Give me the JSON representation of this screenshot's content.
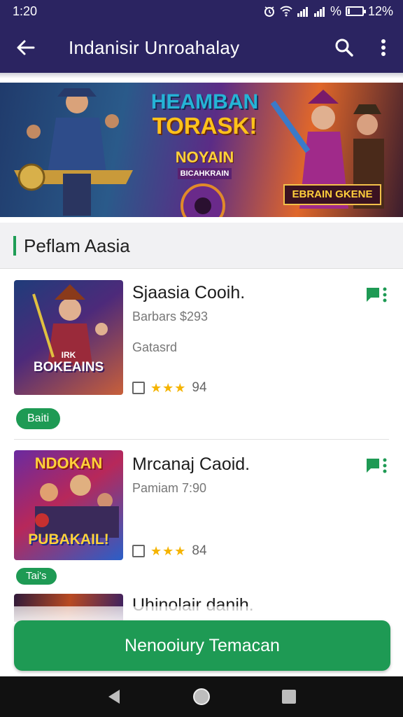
{
  "status_bar": {
    "time": "1:20",
    "signal_text": "%",
    "battery_text": "12%",
    "battery_level": 0.12,
    "icons": [
      "alarm-icon",
      "wifi-icon",
      "signal-icon",
      "signal-icon",
      "battery-icon"
    ]
  },
  "app_bar": {
    "title": "Indanisir Unroahalay",
    "back_icon": "back-arrow-icon",
    "search_icon": "search-icon",
    "more_icon": "more-vert-icon"
  },
  "banner": {
    "line1": "HEAMBAN",
    "line2": "TORASK!",
    "line3": "NOYAIN",
    "line4": "BICAHKRAIN",
    "badge": "EBRAIN GKENE"
  },
  "section": {
    "title": "Peflam Aasia"
  },
  "items": [
    {
      "title": "Sjaasia Cooih.",
      "subtitle": "Barbars $293",
      "subtitle2": "Gatasrd",
      "stars": "★★★",
      "rating": "94",
      "tag": "Baiti",
      "thumb_text": "BOKEAINS",
      "thumb_small_text": "IRK",
      "flag_icon": "flag-icon"
    },
    {
      "title": "Mrcanaj Caoid.",
      "subtitle": "Pamiam 7:90",
      "stars": "★★★",
      "rating": "84",
      "tag": "Tai's",
      "thumb_text_top": "NDOKAN",
      "thumb_text_bottom": "PUBAKAIL!",
      "flag_icon": "flag-icon"
    },
    {
      "title": "Uhinolair danih."
    }
  ],
  "cta": {
    "label": "Nenooiury Temacan"
  },
  "nav_bar": {
    "back": "nav-back-icon",
    "home": "nav-home-icon",
    "recents": "nav-recents-icon"
  },
  "colors": {
    "app_bar": "#2b2461",
    "accent_green": "#1e9a54",
    "star": "#f5b400"
  }
}
